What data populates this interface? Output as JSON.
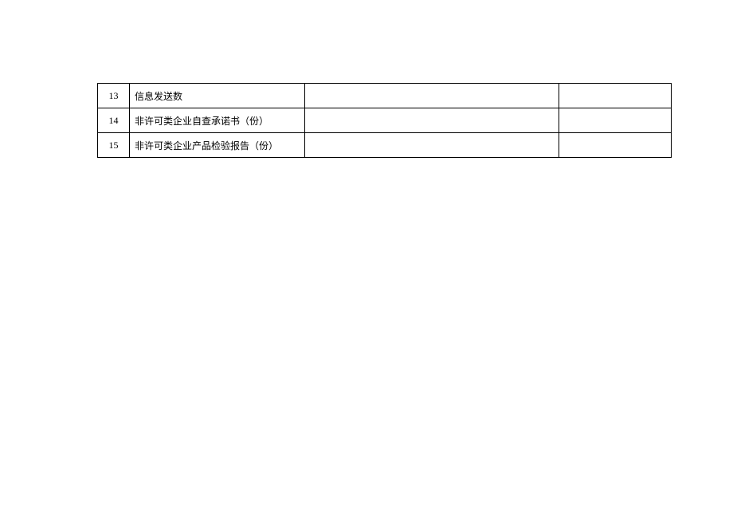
{
  "table": {
    "rows": [
      {
        "num": "13",
        "label": "信息发送数",
        "val1": "",
        "val2": ""
      },
      {
        "num": "14",
        "label": "非许可类企业自查承诺书（份）",
        "val1": "",
        "val2": ""
      },
      {
        "num": "15",
        "label": "非许可类企业产品检验报告（份）",
        "val1": "",
        "val2": ""
      }
    ]
  }
}
